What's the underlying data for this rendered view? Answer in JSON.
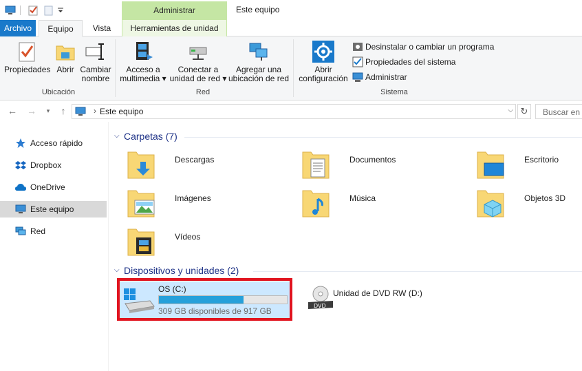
{
  "window": {
    "title": "Este equipo",
    "context_tab_header": "Administrar"
  },
  "tabs": {
    "archivo": "Archivo",
    "equipo": "Equipo",
    "vista": "Vista",
    "herramientas": "Herramientas de unidad"
  },
  "ribbon": {
    "ubicacion": {
      "label": "Ubicación",
      "propiedades": "Propiedades",
      "abrir": "Abrir",
      "cambiar_line1": "Cambiar",
      "cambiar_line2": "nombre"
    },
    "red": {
      "label": "Red",
      "acceso_line1": "Acceso a",
      "acceso_line2": "multimedia",
      "conectar_line1": "Conectar a",
      "conectar_line2": "unidad de red",
      "agregar_line1": "Agregar una",
      "agregar_line2": "ubicación de red"
    },
    "sistema": {
      "label": "Sistema",
      "abrir_line1": "Abrir",
      "abrir_line2": "configuración",
      "desinstalar": "Desinstalar o cambiar un programa",
      "propiedades_sistema": "Propiedades del sistema",
      "administrar": "Administrar"
    }
  },
  "address": {
    "path": "Este equipo",
    "search_placeholder": "Buscar en E"
  },
  "nav_pane": {
    "items": [
      {
        "label": "Acceso rápido",
        "icon": "star-icon"
      },
      {
        "label": "Dropbox",
        "icon": "dropbox-icon"
      },
      {
        "label": "OneDrive",
        "icon": "onedrive-icon"
      },
      {
        "label": "Este equipo",
        "icon": "computer-icon",
        "selected": true
      },
      {
        "label": "Red",
        "icon": "network-icon"
      }
    ]
  },
  "folders_section": {
    "title": "Carpetas (7)",
    "items": [
      {
        "label": "Descargas",
        "icon": "downloads-folder-icon"
      },
      {
        "label": "Documentos",
        "icon": "documents-folder-icon"
      },
      {
        "label": "Escritorio",
        "icon": "desktop-folder-icon"
      },
      {
        "label": "Imágenes",
        "icon": "pictures-folder-icon"
      },
      {
        "label": "Música",
        "icon": "music-folder-icon"
      },
      {
        "label": "Objetos 3D",
        "icon": "3d-objects-folder-icon"
      },
      {
        "label": "Vídeos",
        "icon": "videos-folder-icon"
      }
    ]
  },
  "devices_section": {
    "title": "Dispositivos y unidades (2)",
    "drives": [
      {
        "name": "OS (C:)",
        "free_text": "309 GB disponibles de 917 GB",
        "used_fraction": 0.663,
        "selected": true
      },
      {
        "name": "Unidad de DVD RW (D:)",
        "dvd_label": "DVD"
      }
    ]
  },
  "colors": {
    "accent": "#1979ca",
    "section_title": "#1e3287",
    "context_tab": "#c5e6a4",
    "progress": "#26a0da",
    "highlight": "#e1141f"
  }
}
